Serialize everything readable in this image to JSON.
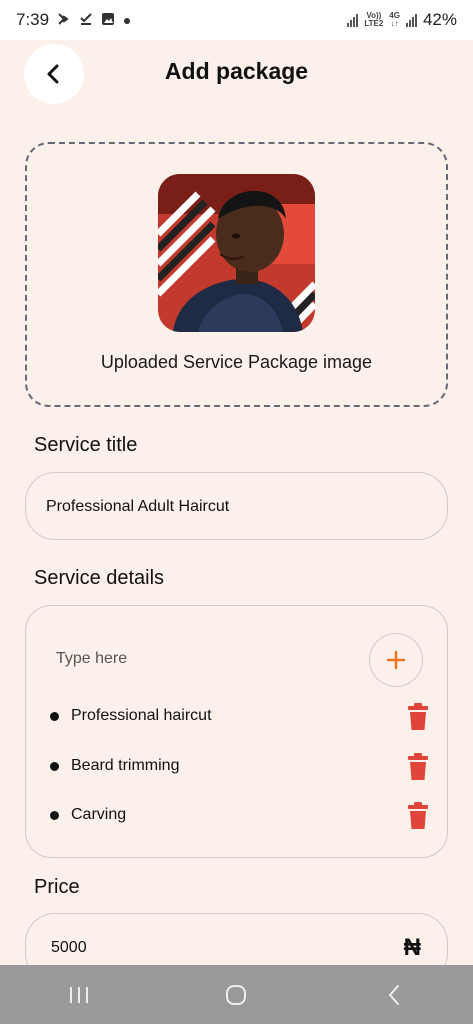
{
  "status_bar": {
    "time": "7:39",
    "network_label_top": "Vo))",
    "network_label_bottom": "LTE2",
    "network_type": "4G",
    "battery": "42%"
  },
  "header": {
    "title": "Add package",
    "back_icon": "chevron-left-icon"
  },
  "upload": {
    "caption": "Uploaded Service Package image"
  },
  "service_title": {
    "label": "Service title",
    "value": "Professional Adult Haircut"
  },
  "service_details": {
    "label": "Service details",
    "placeholder": "Type here",
    "items": [
      {
        "label": "Professional haircut"
      },
      {
        "label": "Beard trimming"
      },
      {
        "label": "Carving"
      }
    ]
  },
  "price": {
    "label": "Price",
    "value": "5000",
    "currency_symbol": "₦"
  },
  "colors": {
    "background": "#fcf0ea",
    "accent": "#e8761f",
    "delete": "#e0453a"
  }
}
